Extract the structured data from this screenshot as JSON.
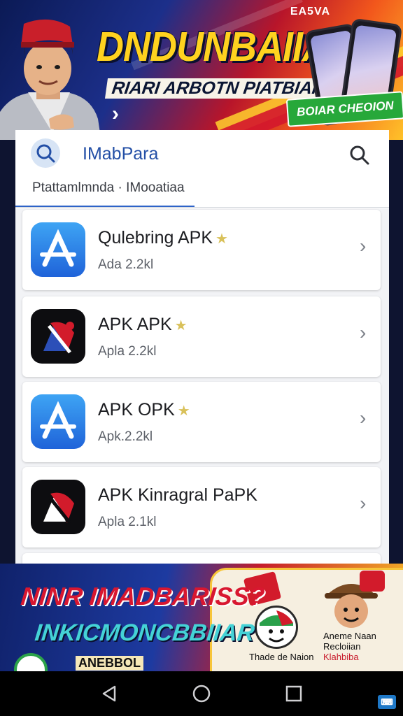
{
  "top_banner": {
    "corner_tag": "EA5VA",
    "title": "DNDUNBAIIA",
    "subtitle": "RIARI ARBOTN PIATBIAHUIK",
    "cta_label": "BOIAR CHEOION",
    "next_glyph": "›"
  },
  "search": {
    "title": "IMabPara",
    "subtitle": "Ptattamlmnda · IMooatiaa"
  },
  "apps": [
    {
      "name": "Qulebring APK",
      "meta": "Ada 2.2kl",
      "icon": "app-store-icon",
      "star": true
    },
    {
      "name": "APK APK",
      "meta": "Apla 2.2kl",
      "icon": "apk-dark-icon",
      "star": true
    },
    {
      "name": "APK OPK",
      "meta": "Apk.2.2kl",
      "icon": "app-store-icon",
      "star": true
    },
    {
      "name": "APK Kinragral PaPK",
      "meta": "Apla 2.1kl",
      "icon": "apk-dark-icon",
      "star": false
    }
  ],
  "bottom_banner": {
    "headline": "NINR IMADBARISS?",
    "subline": "INKICMONCBBIIAR",
    "small_text": "ANEBBOL",
    "caption_left": "Thade de Naion",
    "caption_right_1": "Aneme Naan",
    "caption_right_2": "Recloiian",
    "caption_right_3": "Klahbiba"
  },
  "navbar": {
    "keyboard_label": "⌨"
  },
  "colors": {
    "accent_blue": "#234fa6",
    "tab_underline": "#2e63c8",
    "banner_yellow": "#ffd21f",
    "cta_green": "#27a83a"
  }
}
